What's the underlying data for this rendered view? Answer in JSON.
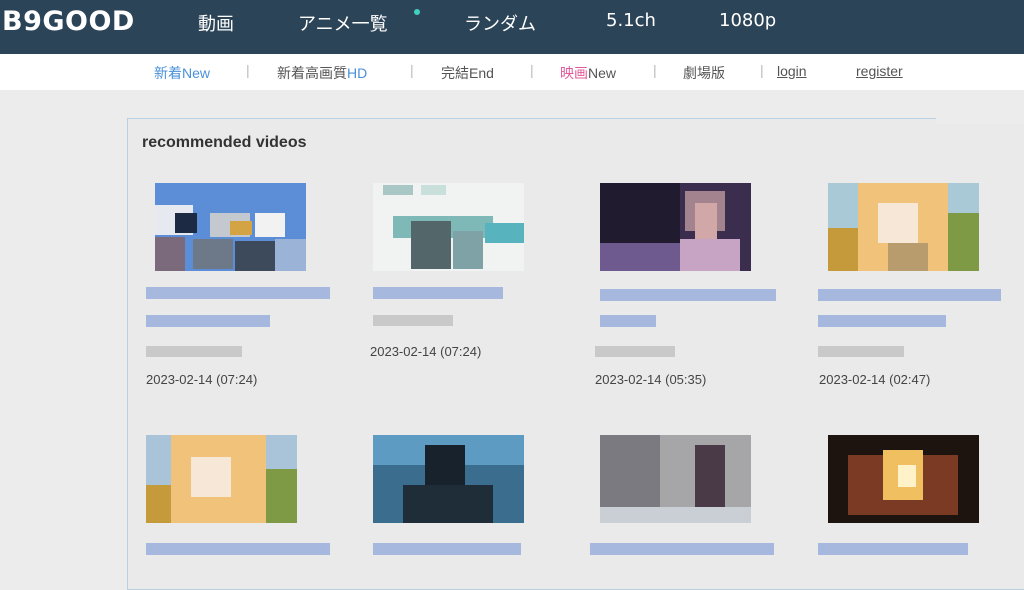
{
  "header": {
    "brand": "B9GOOD",
    "nav": [
      "動画",
      "アニメ一覧",
      "ランダム",
      "5.1ch",
      "1080p"
    ]
  },
  "subnav": [
    {
      "main": "新着",
      "tag": "New"
    },
    {
      "main": "新着高画質",
      "tag": "HD"
    },
    {
      "main": "完結",
      "tag": "End"
    },
    {
      "main": "映画",
      "tag": "New"
    },
    {
      "main": "劇場版",
      "tag": ""
    },
    {
      "main": "login",
      "tag": ""
    },
    {
      "main": "register",
      "tag": ""
    }
  ],
  "section": {
    "title": "recommended videos"
  },
  "videos": [
    {
      "date": "2023-02-14 (07:24)"
    },
    {
      "date": "2023-02-14 (07:24)"
    },
    {
      "date": "2023-02-14 (05:35)"
    },
    {
      "date": "2023-02-14 (02:47)"
    },
    {
      "date": ""
    },
    {
      "date": ""
    },
    {
      "date": ""
    },
    {
      "date": ""
    }
  ],
  "colors": {
    "header_bg": "#2c4458",
    "link_blue": "#4a90d9",
    "link_pink": "#e05a9a"
  }
}
